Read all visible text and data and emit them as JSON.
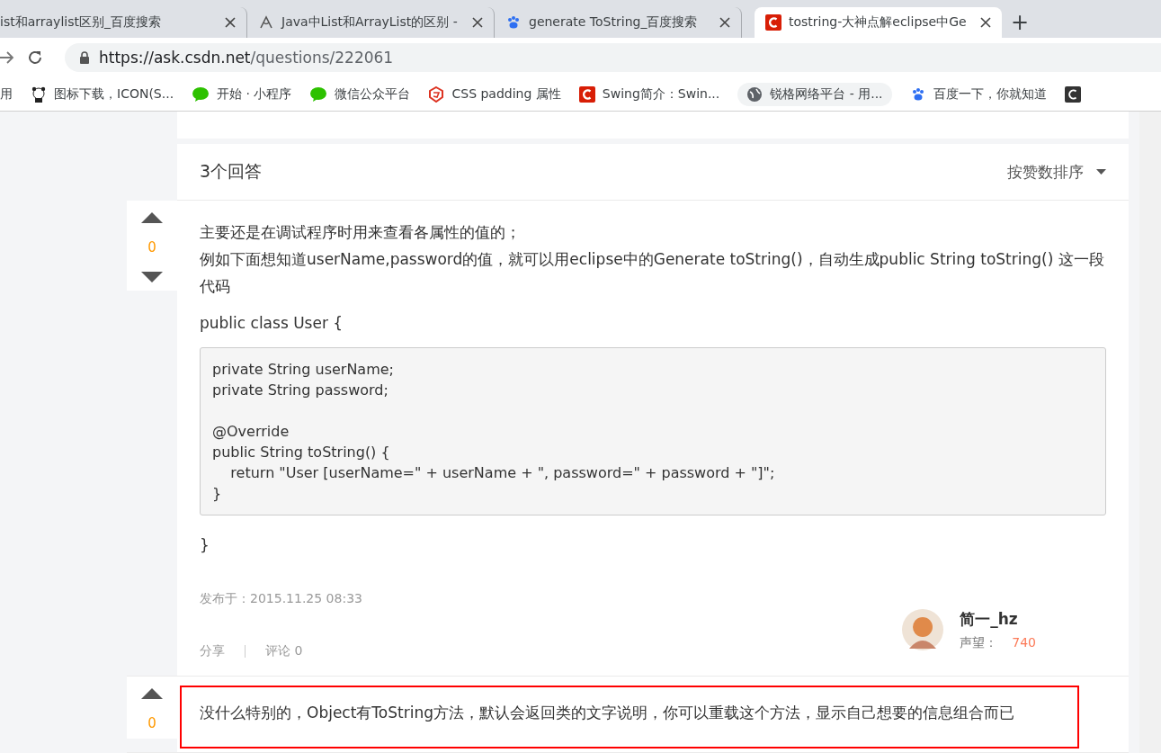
{
  "browser": {
    "tabs": [
      {
        "title": "ist和arraylist区别_百度搜索",
        "selected": false
      },
      {
        "title": "Java中List和ArrayList的区别 -",
        "selected": false
      },
      {
        "title": "generate ToString_百度搜索",
        "selected": false
      },
      {
        "title": "tostring-大神点解eclipse中Ge",
        "selected": true
      }
    ],
    "new_tab": "+",
    "url_host": "https://ask.csdn.net",
    "url_path": "/questions/222061",
    "bookmarks": [
      {
        "label": "用"
      },
      {
        "label": "图标下载，ICON(S..."
      },
      {
        "label": "开始 · 小程序"
      },
      {
        "label": "微信公众平台"
      },
      {
        "label": "CSS padding 属性"
      },
      {
        "label": "Swing简介：Swin..."
      },
      {
        "label": "锐格网络平台 - 用..."
      },
      {
        "label": "百度一下，你就知道"
      },
      {
        "kind": "icon_only"
      }
    ]
  },
  "answers_header": {
    "title": "3个回答",
    "sort": "按赞数排序"
  },
  "answers": [
    {
      "votes": "0",
      "highlighted": false,
      "paragraphs": [
        "主要还是在调试程序时用来查看各属性的值的；",
        "例如下面想知道userName,password的值，就可以用eclipse中的Generate toString()，自动生成public String toString() 这一段代码",
        "public class User {"
      ],
      "code": [
        [
          "private String userName;",
          "private String password;"
        ],
        [
          "@Override",
          "public String toString() {",
          "    return \"User [userName=\" + userName + \", password=\" + password + \"]\";",
          "}"
        ]
      ],
      "after": "}",
      "posted": "发布于：2015.11.25 08:33",
      "actions": [
        "分享",
        "评论 0"
      ],
      "author": {
        "name": "简一_hz",
        "rep_label": "声望：",
        "rep": "740"
      }
    },
    {
      "votes": "0",
      "highlighted": true,
      "paragraphs": [
        "没什么特别的，Object有ToString方法，默认会返回类的文字说明，你可以重载这个方法，显示自己想要的信息组合而已"
      ]
    }
  ]
}
